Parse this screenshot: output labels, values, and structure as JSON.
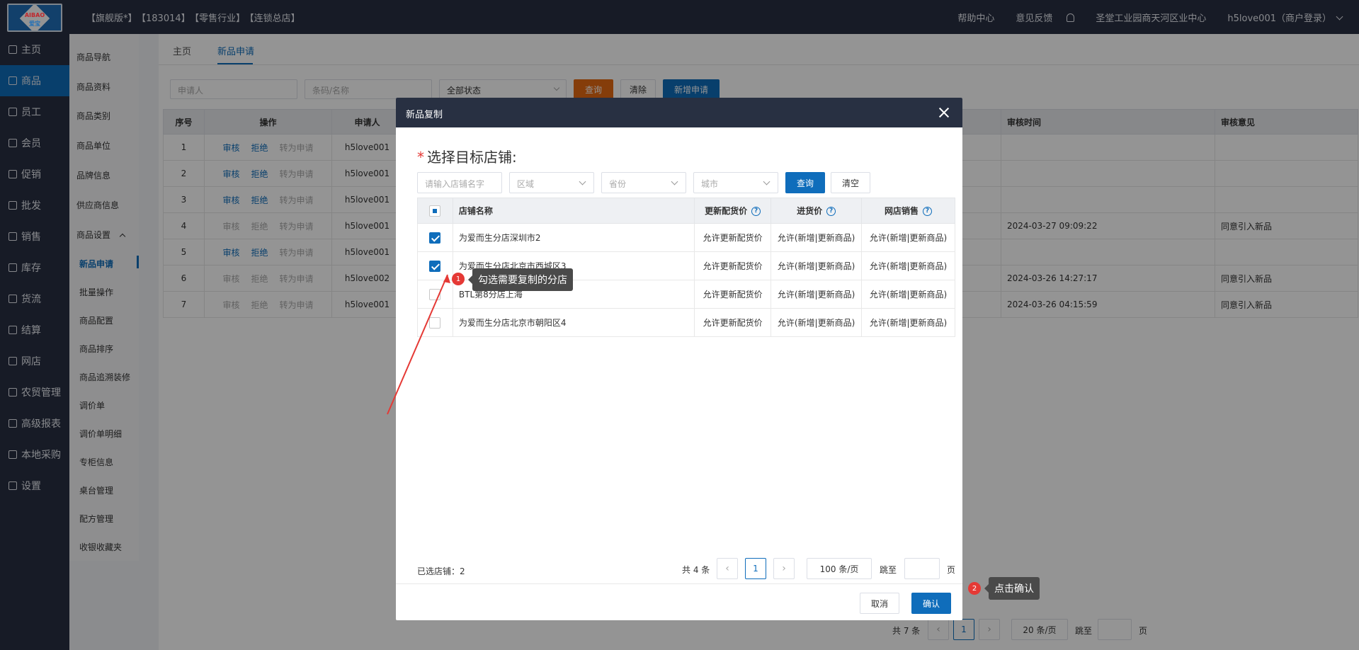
{
  "logo": {
    "line1": "AIBAO",
    "line2": "爱宝"
  },
  "header": {
    "edition": "【旗舰版*】",
    "code": "【183014】",
    "industry": "【零售行业】",
    "store": "【连锁总店】",
    "help": "帮助中心",
    "feedback": "意见反馈",
    "org": "圣堂工业园商天河区业中心",
    "user": "h5love001（商户登录）"
  },
  "leftnav": [
    "主页",
    "商品",
    "员工",
    "会员",
    "促销",
    "批发",
    "销售",
    "库存",
    "货流",
    "结算",
    "网店",
    "农贸管理",
    "高级报表",
    "本地采购",
    "设置"
  ],
  "subnav": [
    "商品导航",
    "商品资料",
    "商品类别",
    "商品单位",
    "品牌信息",
    "供应商信息",
    "商品设置",
    "新品申请",
    "批量操作",
    "商品配置",
    "商品排序",
    "商品追溯装修",
    "调价单",
    "调价单明细",
    "专柜信息",
    "桌台管理",
    "配方管理",
    "收银收藏夹"
  ],
  "tabs": {
    "home": "主页",
    "current": "新品申请"
  },
  "filters": {
    "applicant_placeholder": "申请人",
    "barcode_placeholder": "条码/名称",
    "status": "全部状态",
    "query": "查询",
    "clear": "清除",
    "new": "新增申请"
  },
  "bgtable": {
    "headers": [
      "序号",
      "操作",
      "申请人",
      "审核时间",
      "审核意见"
    ],
    "actions": {
      "approve": "审核",
      "reject": "拒绝",
      "convert": "转为申请"
    },
    "rows": [
      {
        "no": "1",
        "applicant": "h5love001",
        "time": "",
        "opinion": "",
        "enabled": true
      },
      {
        "no": "2",
        "applicant": "h5love001",
        "time": "",
        "opinion": "",
        "enabled": true
      },
      {
        "no": "3",
        "applicant": "h5love001",
        "time": "",
        "opinion": "",
        "enabled": true
      },
      {
        "no": "4",
        "applicant": "h5love001",
        "time": "2024-03-27 09:09:22",
        "opinion": "同意引入新品",
        "enabled": false
      },
      {
        "no": "5",
        "applicant": "h5love001",
        "time": "",
        "opinion": "",
        "enabled": true
      },
      {
        "no": "6",
        "applicant": "h5love002",
        "time": "2024-03-26 14:27:17",
        "opinion": "同意引入新品",
        "enabled": false
      },
      {
        "no": "7",
        "applicant": "h5love001",
        "time": "2024-03-26 04:15:59",
        "opinion": "同意引入新品",
        "enabled": false
      }
    ]
  },
  "bgpager": {
    "total": "共 7 条",
    "page": "1",
    "size": "20 条/页",
    "goto": "跳至",
    "unit": "页"
  },
  "modal": {
    "title": "新品复制",
    "section_title": "选择目标店铺:",
    "filter": {
      "name_placeholder": "请输入店铺名字",
      "region": "区域",
      "province": "省份",
      "city": "城市",
      "query": "查询",
      "clear": "清空"
    },
    "headers": {
      "name": "店铺名称",
      "update_price": "更新配货价",
      "purchase_price": "进货价",
      "online": "网店销售"
    },
    "rows": [
      {
        "name": "为爱而生分店深圳市2",
        "update_price": "允许更新配货价",
        "purchase": "允许(新增|更新商品)",
        "online": "允许(新增|更新商品)",
        "checked": true
      },
      {
        "name": "为爱而生分店北京市西城区3",
        "update_price": "允许更新配货价",
        "purchase": "允许(新增|更新商品)",
        "online": "允许(新增|更新商品)",
        "checked": true
      },
      {
        "name": "BTL第8分店上海",
        "update_price": "允许更新配货价",
        "purchase": "允许(新增|更新商品)",
        "online": "允许(新增|更新商品)",
        "checked": false
      },
      {
        "name": "为爱而生分店北京市朝阳区4",
        "update_price": "允许更新配货价",
        "purchase": "允许(新增|更新商品)",
        "online": "允许(新增|更新商品)",
        "checked": false
      }
    ],
    "selected_count": "已选店铺：2",
    "pager": {
      "total": "共 4 条",
      "page": "1",
      "size": "100 条/页",
      "goto": "跳至",
      "unit": "页"
    },
    "cancel": "取消",
    "confirm": "确认"
  },
  "annotations": [
    {
      "num": "1",
      "text": "勾选需要复制的分店"
    },
    {
      "num": "2",
      "text": "点击确认"
    }
  ]
}
